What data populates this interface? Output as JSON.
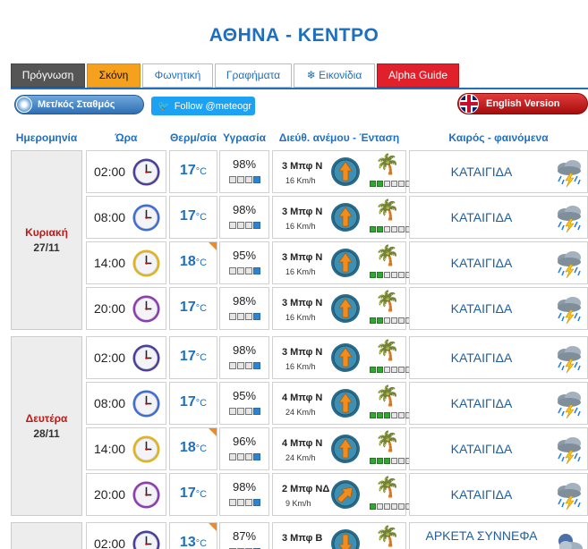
{
  "page": {
    "title": "ΑΘΗΝΑ - ΚΕΝΤΡΟ"
  },
  "tabs": [
    {
      "label": "Πρόγνωση",
      "active": true
    },
    {
      "label": "Σκόνη"
    },
    {
      "label": "Φωνητική"
    },
    {
      "label": "Γραφήματα"
    },
    {
      "label": "Εικονίδια",
      "icon": "snowflake-icon"
    },
    {
      "label": "Alpha Guide"
    }
  ],
  "buttons": {
    "station": "Μετ/κός Σταθμός",
    "follow": "Follow @meteogr",
    "english": "English Version"
  },
  "columns": {
    "date": "Ημερομηνία",
    "time": "Ώρα",
    "temp": "Θερμ/σία",
    "humidity": "Υγρασία",
    "wind": "Διεύθ. ανέμου - Ένταση",
    "weather": "Καιρός - φαινόμενα"
  },
  "temp_unit": "°C",
  "colors": {
    "accent": "#1f6fbf",
    "active_tab": "#555555",
    "dust_tab": "#f6a11e",
    "alpha_tab": "#e0202a",
    "day_name": "#b71c1c"
  },
  "days": [
    {
      "name": "Κυριακή",
      "date": "27/11",
      "rows": [
        {
          "time": "02:00",
          "clock": "night",
          "temp": "17",
          "humidity": "98%",
          "hum_level": 4,
          "wind": "3 Μπφ Ν",
          "kmh": "16 Km/h",
          "wind_level": 1,
          "condition": "ΚΑΤΑΙΓΙΔΑ",
          "icon": "thunderstorm-icon"
        },
        {
          "time": "08:00",
          "clock": "day",
          "temp": "17",
          "humidity": "98%",
          "hum_level": 4,
          "wind": "3 Μπφ Ν",
          "kmh": "16 Km/h",
          "wind_level": 1,
          "condition": "ΚΑΤΑΙΓΙΔΑ",
          "icon": "thunderstorm-icon"
        },
        {
          "time": "14:00",
          "clock": "noon",
          "temp": "18",
          "max": true,
          "humidity": "95%",
          "hum_level": 4,
          "wind": "3 Μπφ Ν",
          "kmh": "16 Km/h",
          "wind_level": 1,
          "condition": "ΚΑΤΑΙΓΙΔΑ",
          "icon": "thunderstorm-icon"
        },
        {
          "time": "20:00",
          "clock": "evening",
          "temp": "17",
          "humidity": "98%",
          "hum_level": 4,
          "wind": "3 Μπφ Ν",
          "kmh": "16 Km/h",
          "wind_level": 1,
          "condition": "ΚΑΤΑΙΓΙΔΑ",
          "icon": "thunderstorm-icon"
        }
      ]
    },
    {
      "name": "Δευτέρα",
      "date": "28/11",
      "rows": [
        {
          "time": "02:00",
          "clock": "night",
          "temp": "17",
          "humidity": "98%",
          "hum_level": 4,
          "wind": "3 Μπφ Ν",
          "kmh": "16 Km/h",
          "wind_level": 1,
          "condition": "ΚΑΤΑΙΓΙΔΑ",
          "icon": "thunderstorm-icon"
        },
        {
          "time": "08:00",
          "clock": "day",
          "temp": "17",
          "humidity": "95%",
          "hum_level": 4,
          "wind": "4 Μπφ Ν",
          "kmh": "24 Km/h",
          "wind_level": 2,
          "condition": "ΚΑΤΑΙΓΙΔΑ",
          "icon": "thunderstorm-icon"
        },
        {
          "time": "14:00",
          "clock": "noon",
          "temp": "18",
          "max": true,
          "humidity": "96%",
          "hum_level": 4,
          "wind": "4 Μπφ Ν",
          "kmh": "24 Km/h",
          "wind_level": 2,
          "condition": "ΚΑΤΑΙΓΙΔΑ",
          "icon": "thunderstorm-icon"
        },
        {
          "time": "20:00",
          "clock": "evening",
          "temp": "17",
          "humidity": "98%",
          "hum_level": 4,
          "wind": "2 Μπφ ΝΔ",
          "kmh": "9 Km/h",
          "wind_level": 0,
          "condition": "ΚΑΤΑΙΓΙΔΑ",
          "icon": "thunderstorm-icon"
        }
      ]
    },
    {
      "name": "",
      "date": "",
      "rows": [
        {
          "time": "02:00",
          "clock": "night",
          "temp": "13",
          "max": true,
          "humidity": "87%",
          "hum_level": 4,
          "wind": "3 Μπφ Β",
          "kmh": "",
          "wind_level": 1,
          "condition": "ΑΡΚΕΤΑ ΣΥΝΝΕΦΑ",
          "icon": "cloudy-night-icon"
        }
      ]
    }
  ]
}
